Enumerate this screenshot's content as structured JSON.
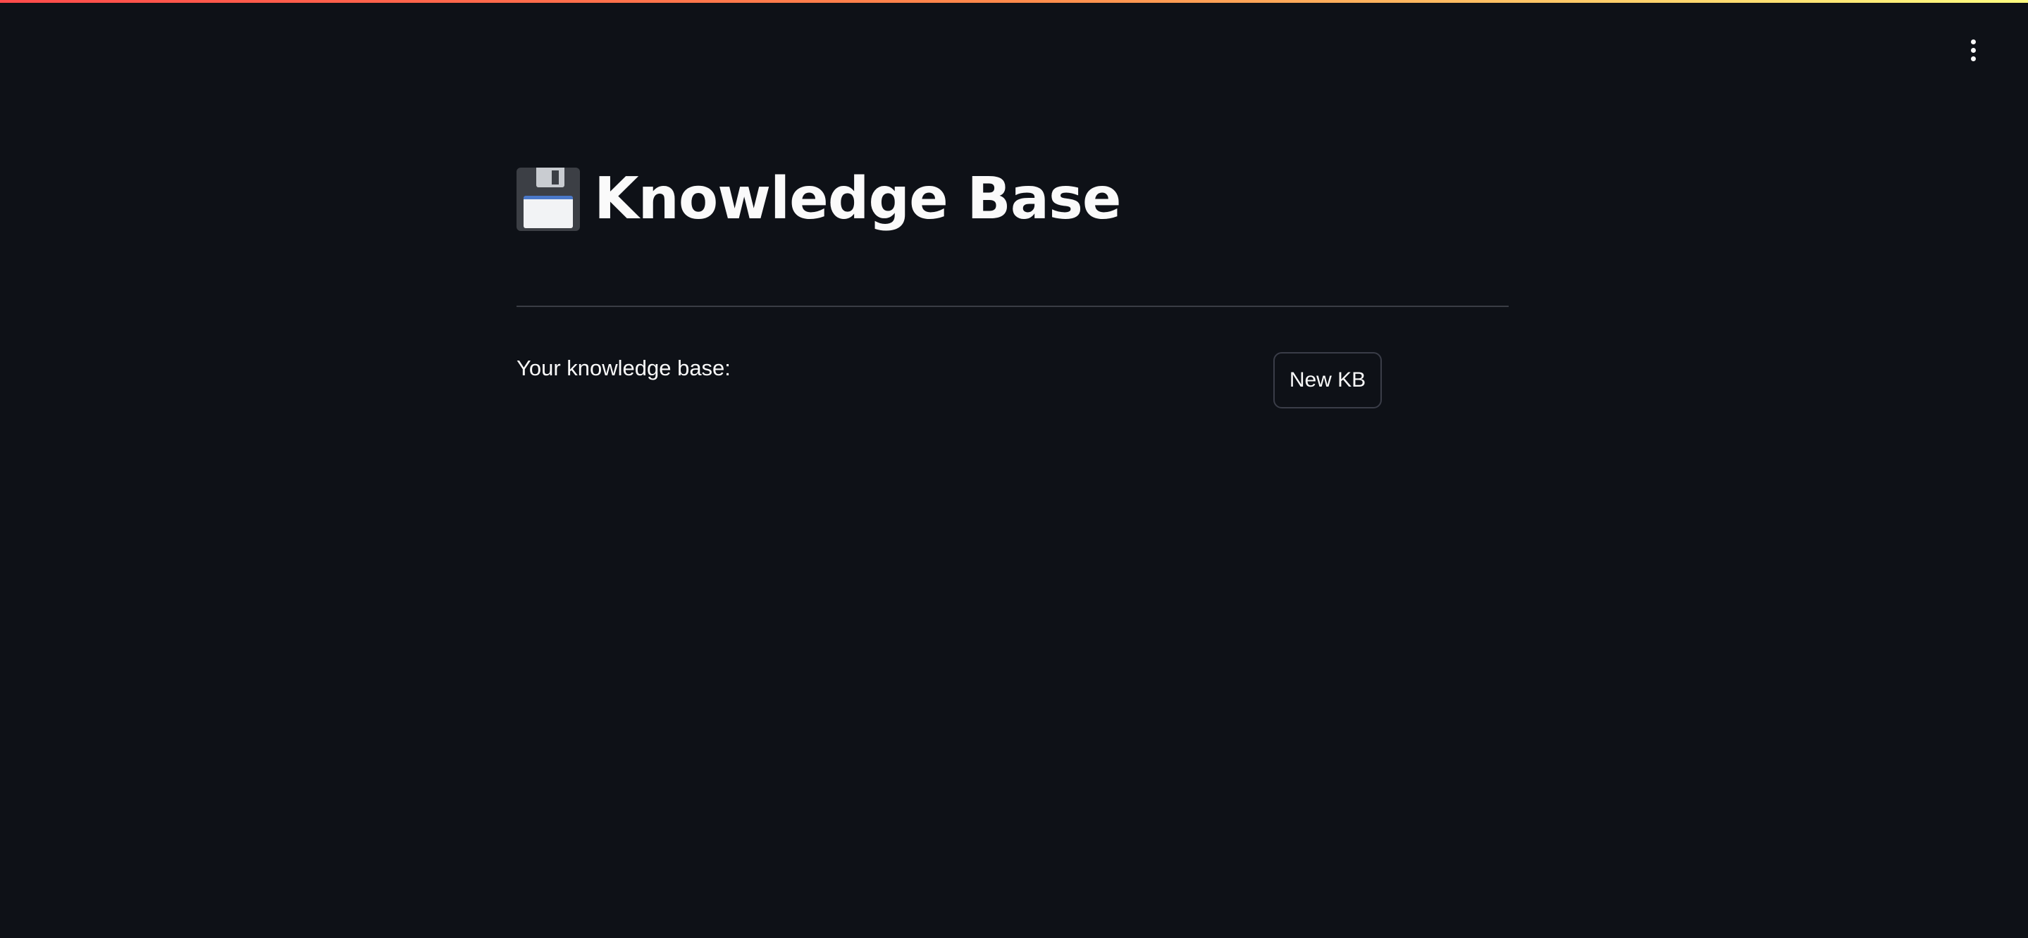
{
  "header": {
    "menu_icon": "more-vertical-icon"
  },
  "main": {
    "title_icon": "floppy-disk-icon",
    "title": "Knowledge Base",
    "kb_label": "Your knowledge base:",
    "new_kb_button_label": "New KB"
  },
  "colors": {
    "background": "#0e1117",
    "text": "#fafafa",
    "divider": "#3a3d45",
    "button_border": "#3a3d48",
    "decoration_start": "#ff4b4b",
    "decoration_end": "#fffd80"
  }
}
